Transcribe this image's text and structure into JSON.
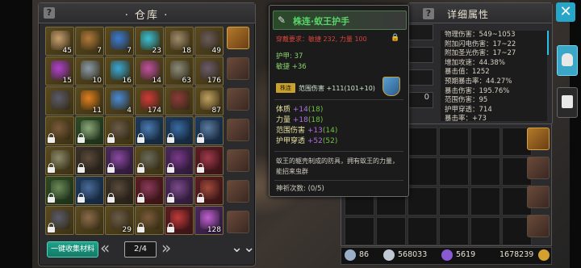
{
  "warehouse": {
    "title": "· 仓库 ·",
    "collect_label": "一键收集材料",
    "page": "2/4",
    "cells": [
      {
        "c": "gold",
        "n": "45",
        "lock": false,
        "g": "#c8a070"
      },
      {
        "c": "gold",
        "n": "7",
        "lock": false,
        "g": "#b07a3a"
      },
      {
        "c": "gold",
        "n": "7",
        "lock": false,
        "g": "#3a7ad4"
      },
      {
        "c": "gold",
        "n": "23",
        "lock": false,
        "g": "#3ac0d4"
      },
      {
        "c": "gold",
        "n": "18",
        "lock": false,
        "g": "#a08a6a"
      },
      {
        "c": "gold",
        "n": "49",
        "lock": false,
        "g": "#6a5a5a"
      },
      {
        "c": "gold",
        "n": "15",
        "lock": false,
        "g": "#b040d0"
      },
      {
        "c": "gold",
        "n": "10",
        "lock": false,
        "g": "#8a9aa8"
      },
      {
        "c": "gold",
        "n": "16",
        "lock": false,
        "g": "#3aa8d4"
      },
      {
        "c": "gold",
        "n": "14",
        "lock": false,
        "g": "#c050a0"
      },
      {
        "c": "gold",
        "n": "63",
        "lock": false,
        "g": "#8a8a7a"
      },
      {
        "c": "gold",
        "n": "176",
        "lock": false,
        "g": "#6a5a6a"
      },
      {
        "c": "gold",
        "n": "",
        "lock": false,
        "g": "#5a5a6a"
      },
      {
        "c": "gold",
        "n": "11",
        "lock": false,
        "g": "#e08020"
      },
      {
        "c": "gold",
        "n": "4",
        "lock": false,
        "g": "#4a8ad4"
      },
      {
        "c": "gold",
        "n": "174",
        "lock": false,
        "g": "#d03a3a"
      },
      {
        "c": "gold",
        "n": "",
        "lock": false,
        "g": "#8a3a3a"
      },
      {
        "c": "gold",
        "n": "87",
        "lock": false,
        "g": "#c0a060"
      },
      {
        "c": "gold",
        "n": "",
        "lock": true,
        "g": "#7a5a3a"
      },
      {
        "c": "green",
        "n": "",
        "lock": true,
        "g": "#8aa87a"
      },
      {
        "c": "gold",
        "n": "",
        "lock": true,
        "g": "#6a5a4a"
      },
      {
        "c": "blue",
        "n": "",
        "lock": true,
        "g": "#4a7ab0"
      },
      {
        "c": "blue",
        "n": "",
        "lock": true,
        "g": "#3a6aa0"
      },
      {
        "c": "blue",
        "n": "",
        "lock": true,
        "g": "#5a7aa0"
      },
      {
        "c": "gold",
        "n": "",
        "lock": true,
        "g": "#8a8a6a"
      },
      {
        "c": "dark",
        "n": "",
        "lock": true,
        "g": "#5a4a3a"
      },
      {
        "c": "purple",
        "n": "",
        "lock": true,
        "g": "#8a4aa0"
      },
      {
        "c": "gold",
        "n": "",
        "lock": true,
        "g": "#6a6a5a"
      },
      {
        "c": "purple",
        "n": "",
        "lock": true,
        "g": "#7a3a8a"
      },
      {
        "c": "red",
        "n": "",
        "lock": true,
        "g": "#a03a4a"
      },
      {
        "c": "green",
        "n": "",
        "lock": true,
        "g": "#6a8a5a"
      },
      {
        "c": "blue",
        "n": "",
        "lock": true,
        "g": "#4a6a9a"
      },
      {
        "c": "dark",
        "n": "",
        "lock": true,
        "g": "#5a4a3a"
      },
      {
        "c": "red",
        "n": "",
        "lock": true,
        "g": "#8a3a5a"
      },
      {
        "c": "purple",
        "n": "",
        "lock": true,
        "g": "#7a4a8a"
      },
      {
        "c": "red",
        "n": "",
        "lock": true,
        "g": "#a04a3a"
      },
      {
        "c": "gold",
        "n": "",
        "lock": true,
        "g": "#5a5a6a"
      },
      {
        "c": "gold",
        "n": "",
        "lock": false,
        "g": "#8a6a4a"
      },
      {
        "c": "gold",
        "n": "29",
        "lock": false,
        "g": "#6a5a4a"
      },
      {
        "c": "gold",
        "n": "",
        "lock": true,
        "g": "#7a5a3a"
      },
      {
        "c": "red",
        "n": "",
        "lock": true,
        "g": "#c03a3a"
      },
      {
        "c": "purple",
        "n": "128",
        "lock": false,
        "g": "#c060d0"
      }
    ]
  },
  "tooltip": {
    "name": "株连·蚁王护手",
    "requirement": "穿戴要求：敏捷 232, 力量 100",
    "armor": "护甲: 37",
    "agility": "敏捷 +36",
    "set_badge": "株连",
    "set_text": "范围伤害 +111(101+10)",
    "stats": [
      {
        "label": "体质",
        "plus": "+14",
        "par": "(18)"
      },
      {
        "label": "力量",
        "plus": "+18",
        "par": "(18)"
      },
      {
        "label": "范围伤害",
        "plus": "+13",
        "par": "(14)"
      },
      {
        "label": "护甲穿透",
        "plus": "+52",
        "par": "(52)"
      }
    ],
    "desc": "蚁王的躯壳制成的防具，拥有蚁王的力量，能招来虫群",
    "count": "神祈次数: (0/5)"
  },
  "details": {
    "title": "详细属性",
    "rows": [
      "物理伤害：549~1053",
      "附加闪电伤害：17~22",
      "附加圣光伤害：17~27",
      "增加攻速：44.38%",
      "暴击值：1252",
      "预期暴击率：44.27%",
      "暴击伤害：195.76%",
      "范围伤害：95",
      "护甲穿透：714",
      "暴击率：+73"
    ],
    "char_value": "0"
  },
  "resources": {
    "r1": "86",
    "r2": "568033",
    "r3": "5619",
    "r4": "1678239"
  }
}
